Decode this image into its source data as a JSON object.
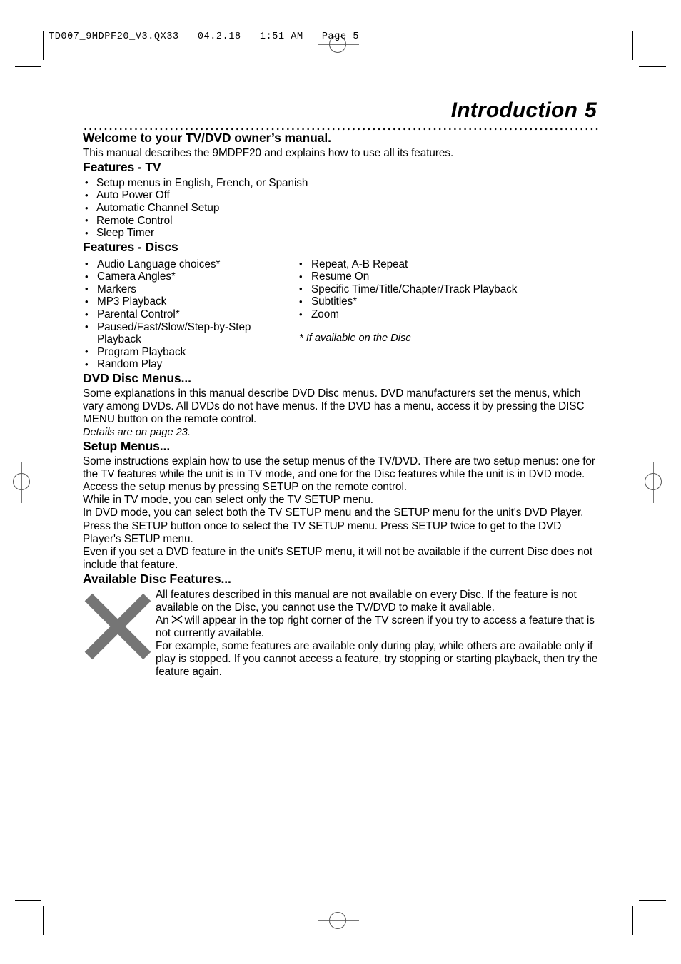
{
  "prepress": {
    "slug": "TD007_9MDPF20_V3.QX33   04.2.18   1:51 AM   Page 5",
    "registration_icon": "registration-crosshair-icon"
  },
  "header": {
    "title": "Introduction",
    "page_number": "5"
  },
  "sections": {
    "welcome": {
      "heading": "Welcome to your TV/DVD owner’s manual.",
      "body": "This manual describes the 9MDPF20 and explains how to use all its features."
    },
    "features_tv": {
      "heading": "Features - TV",
      "items": [
        "Setup menus in English, French, or Spanish",
        "Auto Power Off",
        "Automatic Channel Setup",
        "Remote Control",
        "Sleep Timer"
      ]
    },
    "features_discs": {
      "heading": "Features - Discs",
      "left_items": [
        "Audio Language choices*",
        "Camera Angles*",
        "Markers",
        "MP3 Playback",
        "Parental Control*",
        "Paused/Fast/Slow/Step-by-Step Playback",
        "Program Playback",
        "Random Play"
      ],
      "right_items": [
        "Repeat, A-B Repeat",
        "Resume On",
        "Specific Time/Title/Chapter/Track Playback",
        "Subtitles*",
        "Zoom"
      ],
      "footnote": "* If available on the Disc"
    },
    "dvd_disc_menus": {
      "heading": "DVD Disc Menus...",
      "body": "Some explanations in this manual describe DVD Disc menus. DVD manufacturers set the menus, which vary among DVDs. All DVDs do not have menus. If the DVD has a menu, access it by pressing the DISC MENU button on the remote control.",
      "note": "Details are on page 23."
    },
    "setup_menus": {
      "heading": "Setup Menus...",
      "paragraph_1": "Some instructions explain how to use the setup menus of the TV/DVD. There are two setup menus: one for the TV features while the unit is in TV mode, and one for the Disc features while the unit is in DVD mode. Access the setup menus by pressing SETUP on the remote control.",
      "paragraph_2": "While in TV mode, you can select only the TV SETUP menu.",
      "paragraph_3": "In DVD mode, you can select both the TV SETUP menu and the SETUP menu for the unit's DVD Player. Press the SETUP button once to select the TV SETUP menu. Press SETUP twice to get to the DVD Player's SETUP menu.",
      "paragraph_4": "Even if you set a DVD feature in the unit's SETUP menu, it will not be available if the current Disc does not include that feature."
    },
    "available_disc_features": {
      "heading": "Available Disc Features...",
      "icon": "gray-x-mark-icon",
      "icon_color": "#757575",
      "paragraph_1": "All features described in this manual are not available on every Disc. If the feature is not available on the Disc, you cannot use the TV/DVD to make it available.",
      "paragraph_2_before": "An",
      "paragraph_2_inline_icon": "x-mark-icon",
      "paragraph_2_after": "will appear in the top right corner of the TV screen if you try to access a feature that is not currently available.",
      "paragraph_3": "For example, some features are available only during play, while others are available only if play is stopped.  If you cannot access a feature, try stopping or starting playback, then try the feature again."
    }
  }
}
